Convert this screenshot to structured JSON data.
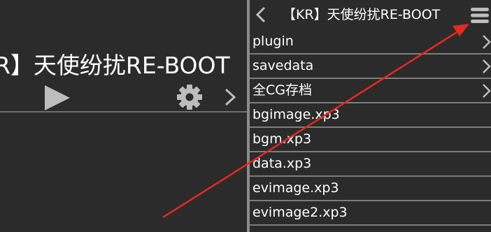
{
  "left_panel": {
    "title": "R】天使纷扰RE-BOOT",
    "icons": [
      "play-icon",
      "gear-icon",
      "chevron-right-icon"
    ]
  },
  "right_panel": {
    "header": {
      "back_icon": "chevron-left-icon",
      "title": "【KR】天使纷扰RE-BOOT",
      "menu_icon": "menu-icon"
    },
    "items": [
      {
        "label": "plugin",
        "type": "folder"
      },
      {
        "label": "savedata",
        "type": "folder"
      },
      {
        "label": "全CG存档",
        "type": "folder"
      },
      {
        "label": "bgimage.xp3",
        "type": "file"
      },
      {
        "label": "bgm.xp3",
        "type": "file"
      },
      {
        "label": "data.xp3",
        "type": "file"
      },
      {
        "label": "evimage.xp3",
        "type": "file"
      },
      {
        "label": "evimage2.xp3",
        "type": "file"
      }
    ]
  },
  "colors": {
    "background": "#2b2b2b",
    "text": "#ffffff",
    "icon": "#bdbdbd",
    "divider": "#7d7d7d",
    "annotation_arrow": "#e8281e"
  }
}
